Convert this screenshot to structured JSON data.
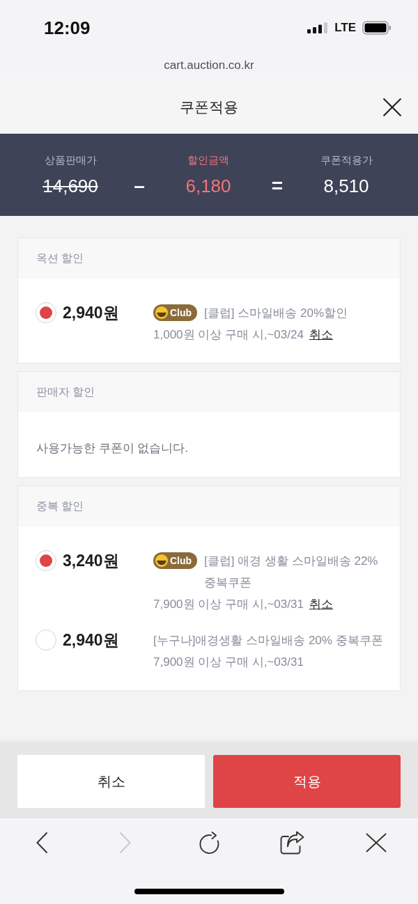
{
  "status_bar": {
    "time": "12:09",
    "network": "LTE"
  },
  "browser": {
    "url": "cart.auction.co.kr"
  },
  "modal": {
    "title": "쿠폰적용"
  },
  "summary": {
    "items": [
      {
        "kind": "original",
        "label": "상품판매가",
        "value": "14,690"
      },
      {
        "kind": "discount",
        "label": "할인금액",
        "value": "6,180"
      },
      {
        "kind": "result",
        "label": "쿠폰적용가",
        "value": "8,510"
      }
    ],
    "operators": [
      "–",
      "="
    ]
  },
  "sections": [
    {
      "title": "옥션 할인",
      "coupons": [
        {
          "selected": true,
          "amount": "2,940원",
          "badge": "Club",
          "name": "[클럽] 스마일배송 20%할인",
          "condition": "1,000원 이상 구매 시,~03/24",
          "action": "취소"
        }
      ]
    },
    {
      "title": "판매자 할인",
      "empty_message": "사용가능한 쿠폰이 없습니다."
    },
    {
      "title": "중복 할인",
      "coupons": [
        {
          "selected": true,
          "amount": "3,240원",
          "badge": "Club",
          "name": "[클럽] 애경 생활 스마일배송 22% 중복쿠폰",
          "condition": "7,900원 이상 구매 시,~03/31",
          "action": "취소"
        },
        {
          "selected": false,
          "amount": "2,940원",
          "name": "[누구나]애경생활 스마일배송 20% 중복쿠폰",
          "condition": "7,900원 이상 구매 시,~03/31"
        }
      ]
    }
  ],
  "actions": [
    {
      "kind": "secondary",
      "label": "취소"
    },
    {
      "kind": "primary",
      "label": "적용"
    }
  ],
  "browser_toolbar": [
    {
      "kind": "back",
      "disabled": false
    },
    {
      "kind": "forward",
      "disabled": true
    },
    {
      "kind": "reload",
      "disabled": false
    },
    {
      "kind": "share",
      "disabled": false
    },
    {
      "kind": "close",
      "disabled": false
    }
  ]
}
